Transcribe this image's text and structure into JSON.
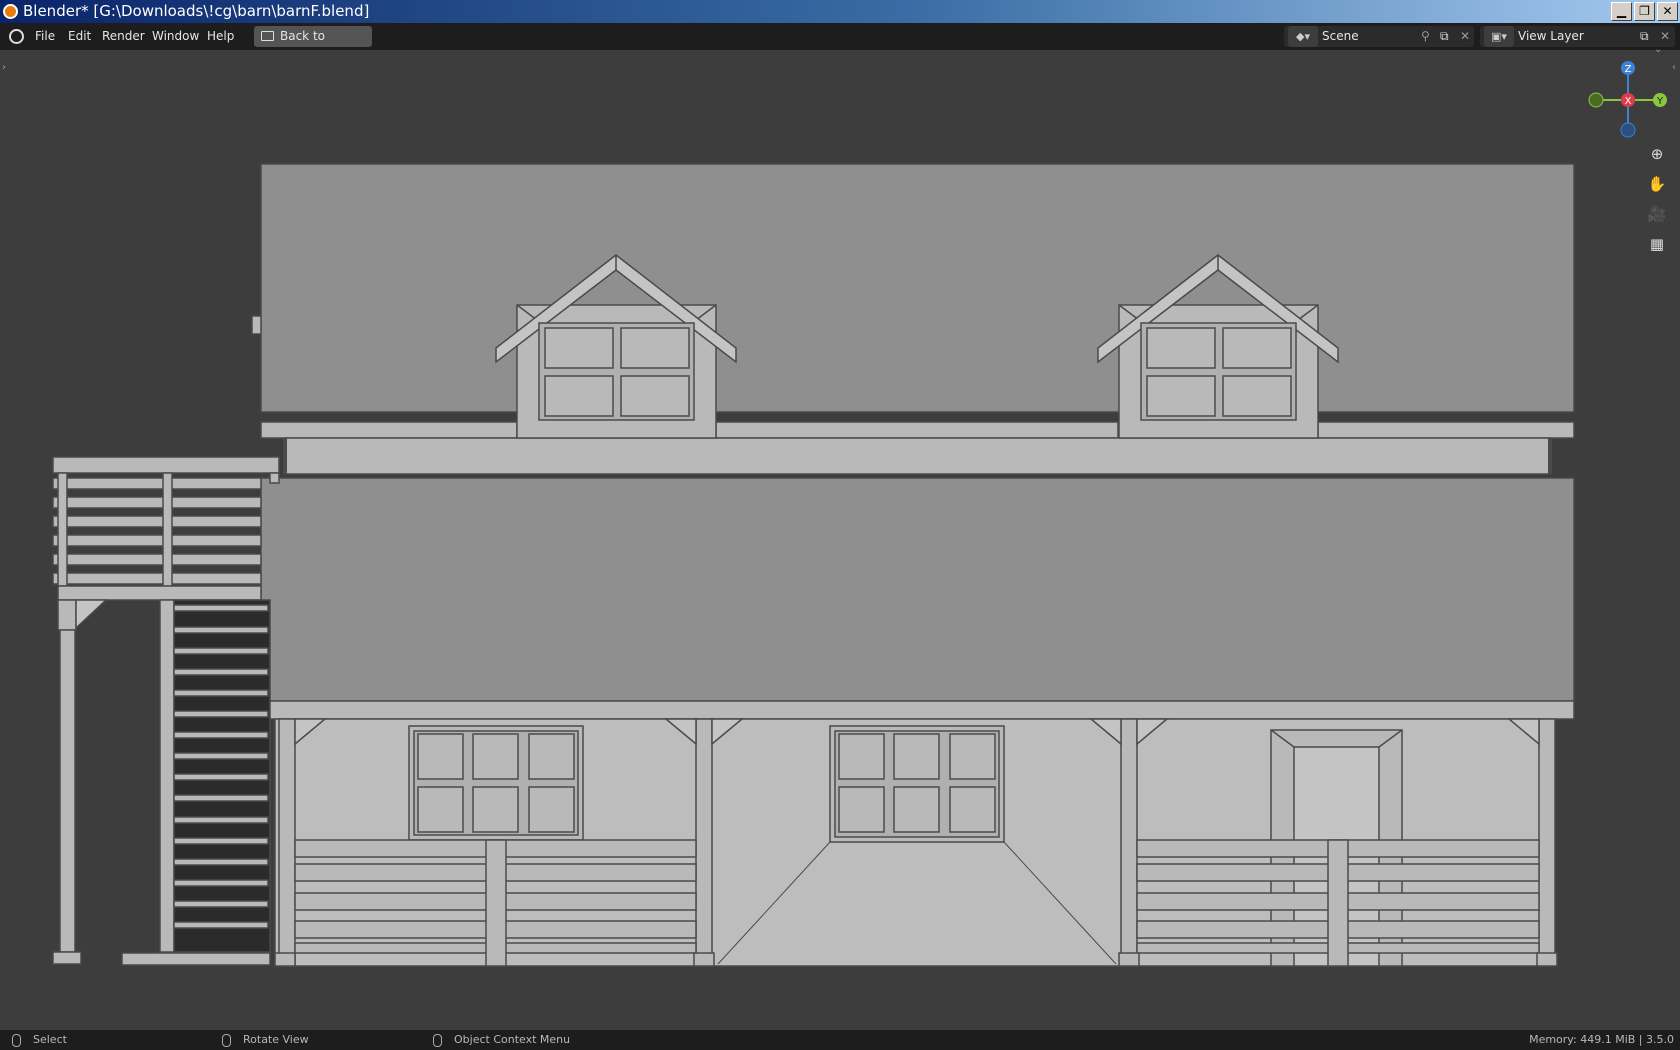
{
  "window": {
    "title": "Blender* [G:\\Downloads\\!cg\\barn\\barnF.blend]",
    "minimize": "0",
    "restore": "1",
    "close": "r"
  },
  "menubar": {
    "items": [
      "File",
      "Edit",
      "Render",
      "Window",
      "Help"
    ],
    "back_button": "Back to Previous",
    "scene_name": "Scene",
    "view_layer": "View Layer"
  },
  "gizmo": {
    "axes": [
      "Z",
      "X",
      "Y"
    ]
  },
  "navigation_buttons": [
    "zoom-icon",
    "hand-pan-icon",
    "camera-icon",
    "grid-icon"
  ],
  "statusbar": {
    "select": "Select",
    "rotate": "Rotate View",
    "context": "Object Context Menu",
    "memory": "Memory: 449.1 MiB | 3.5.0"
  },
  "colors": {
    "viewport_bg": "#3d3d3d",
    "x_axis": "#e03b4b",
    "y_axis": "#8cc63f",
    "z_axis": "#3b82d8",
    "model_light": "#b4b4b4",
    "model_roof": "#8c8c8c"
  }
}
